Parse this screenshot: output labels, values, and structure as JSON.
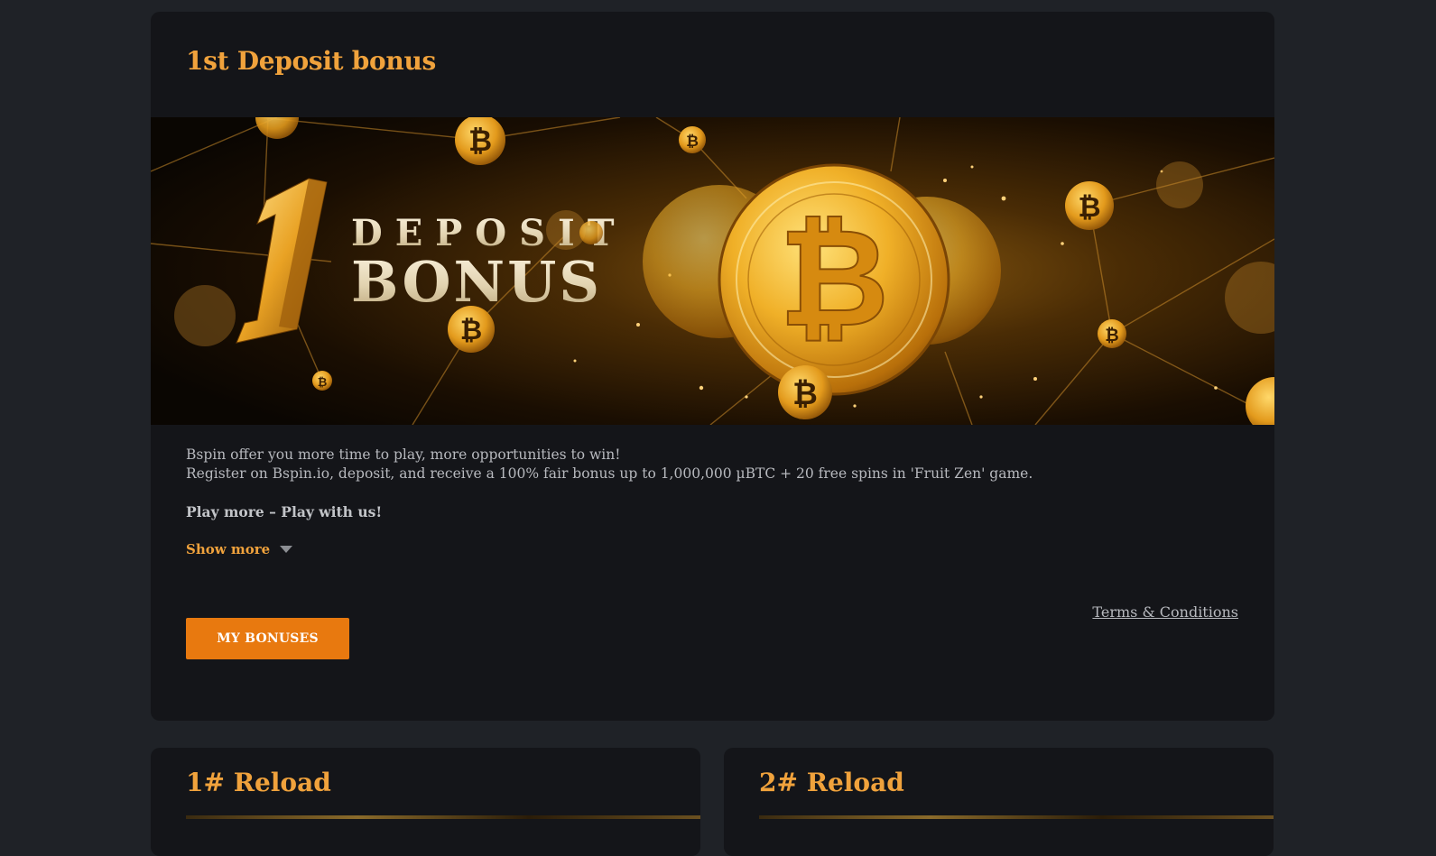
{
  "bonus_card": {
    "title": "1st Deposit bonus",
    "banner": {
      "line1": "DEPOSIT",
      "line2": "BONUS",
      "numeral": "1"
    },
    "description_line1": "Bspin offer you more time to play, more opportunities to win!",
    "description_line2": "Register on Bspin.io, deposit, and receive a 100% fair bonus up to 1,000,000 µBTC + 20 free spins in 'Fruit Zen' game.",
    "tagline": "Play more – Play with us!",
    "show_more_label": "Show more",
    "terms_label": "Terms & Conditions",
    "my_bonuses_label": "MY BONUSES"
  },
  "reload_cards": [
    {
      "title": "1# Reload"
    },
    {
      "title": "2# Reload"
    }
  ],
  "colors": {
    "page_bg": "#1f2227",
    "card_bg": "#141519",
    "accent": "#f0a23c",
    "button": "#e8790f",
    "text": "#b7b9be"
  },
  "icons": [
    "bitcoin-icon",
    "chevron-down-icon"
  ]
}
